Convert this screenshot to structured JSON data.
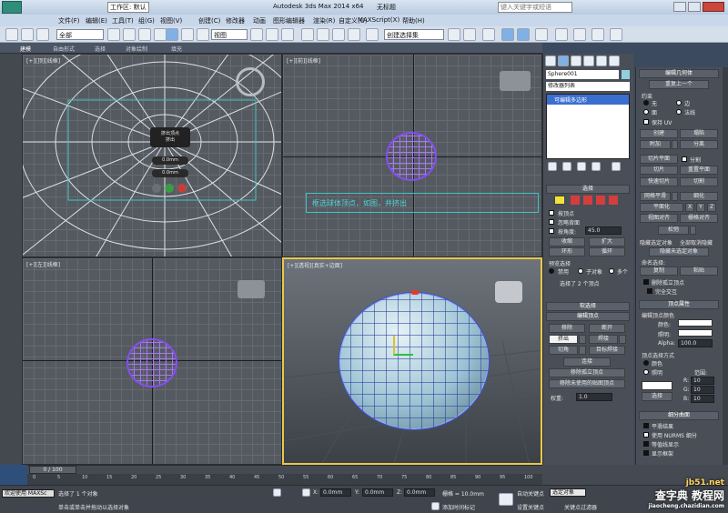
{
  "titlebar": {
    "workspace": "工作区: 默认",
    "app_title": "Autodesk 3ds Max  2014 x64",
    "doc_title": "无标题",
    "search_placeholder": "键入关键字或短语"
  },
  "menubar": {
    "items": [
      "文件(F)",
      "编辑(E)",
      "工具(T)",
      "组(G)",
      "视图(V)",
      "创建(C)",
      "修改器",
      "动画",
      "图形编辑器",
      "渲染(R)",
      "自定义(U)",
      "MAXScript(X)",
      "帮助(H)"
    ]
  },
  "toolbar": {
    "selection_filter": "全部",
    "ref_coord": "视图",
    "selection_set": "创建选择集"
  },
  "ribbon": {
    "items": [
      "建模",
      "自由形式",
      "选择",
      "对象绘制",
      "填充"
    ]
  },
  "viewports": {
    "top_left": {
      "label": "[+][顶][线框]"
    },
    "top_right": {
      "label": "[+][前][线框]"
    },
    "bottom_left": {
      "label": "[+][左][线框]"
    },
    "bottom_right": {
      "label": "[+][透视][真实+边面]"
    }
  },
  "extrude_caddy": {
    "title": "挤出顶点",
    "sub": "挤出",
    "height": "0.0mm",
    "width": "0.0mm"
  },
  "annotation": {
    "text": "框选球体顶点，如图，并挤出"
  },
  "command_panel": {
    "object_name": "Sphere001",
    "modifier_list": "修改器列表",
    "stack_item": "可编辑多边形",
    "selection_title": "选择",
    "by_vertex": "按顶点",
    "ignore_backfacing": "忽略背面",
    "by_angle": "按角度:",
    "angle_value": "45.0",
    "shrink": "收缩",
    "grow": "扩大",
    "ring": "环形",
    "loop": "循环",
    "preview_title": "预览选择",
    "preview_off": "禁用",
    "preview_sub": "子对象",
    "preview_multi": "多个",
    "selected_count": "选择了 2 个顶点",
    "soft_sel": "软选择",
    "edit_vertices": "编辑顶点",
    "remove": "移除",
    "break": "断开",
    "extrude": "挤出",
    "weld": "焊接",
    "chamfer": "切角",
    "target_weld": "目标焊接",
    "connect": "连接",
    "remove_isolated": "移除孤立顶点",
    "remove_unused": "移除未使用的贴图顶点",
    "weight_label": "权重:",
    "weight_value": "1.0"
  },
  "right_panel": {
    "edit_geometry": "编辑几何体",
    "repeat_last": "重复上一个",
    "constraints": "约束",
    "none": "无",
    "edge": "边",
    "face": "面",
    "normal": "法线",
    "preserve_uv": "保持 UV",
    "create": "创建",
    "collapse": "塌陷",
    "attach": "附加",
    "detach": "分离",
    "slice_plane": "切片平面",
    "split": "分割",
    "slice": "切片",
    "reset_plane": "重置平面",
    "quickslice": "快速切片",
    "cut": "切割",
    "meshsmooth": "网格平滑",
    "tessellate": "细化",
    "make_planar": "平面化",
    "x": "X",
    "y": "Y",
    "z": "Z",
    "view_align": "视图对齐",
    "grid_align": "栅格对齐",
    "relax": "松弛",
    "hide_selected": "隐藏选定对象",
    "unhide_all": "全部取消隐藏",
    "hide_unselected": "隐藏未选定对象",
    "named_sel": "命名选择:",
    "copy": "复制",
    "paste": "粘贴",
    "delete_isolated": "删除孤立顶点",
    "full_interactivity": "完全交互",
    "vertex_props": "顶点属性",
    "edit_vertex_colors": "编辑顶点颜色",
    "color": "颜色:",
    "illumination": "照明:",
    "alpha": "Alpha:",
    "alpha_value": "100.0",
    "select_by": "顶点选择方式",
    "by_color": "颜色",
    "by_illum": "照明",
    "range": "范围:",
    "r": "R:",
    "g": "G:",
    "b": "B:",
    "rv": "10",
    "gv": "10",
    "bv": "10",
    "select_btn": "选择",
    "subdiv": "细分曲面",
    "smooth_result": "平滑结果",
    "use_nurms": "使用 NURMS 细分",
    "isoline": "等值线显示",
    "show_cage": "显示框架"
  },
  "timeline": {
    "frame": "0 / 100",
    "ticks": [
      "0",
      "5",
      "10",
      "15",
      "20",
      "25",
      "30",
      "35",
      "40",
      "45",
      "50",
      "55",
      "60",
      "65",
      "70",
      "75",
      "80",
      "85",
      "90",
      "95",
      "100"
    ]
  },
  "statusbar": {
    "welcome": "欢迎使用 MAXSc",
    "status1": "选择了 1 个对象",
    "status2": "单击或单击并拖动以选择对象",
    "x_label": "X:",
    "x_value": "0.0mm",
    "y_label": "Y:",
    "y_value": "0.0mm",
    "z_label": "Z:",
    "z_value": "0.0mm",
    "grid": "栅格 = 10.0mm",
    "add_time_tag": "添加时间标记",
    "auto_key": "自动关键点",
    "selected": "选定对象",
    "set_key": "设置关键点",
    "key_filters": "关键点过滤器"
  },
  "watermark": {
    "site": "jb51.net",
    "text": "查字典 教程网",
    "url": "jiaocheng.chazidian.com"
  }
}
